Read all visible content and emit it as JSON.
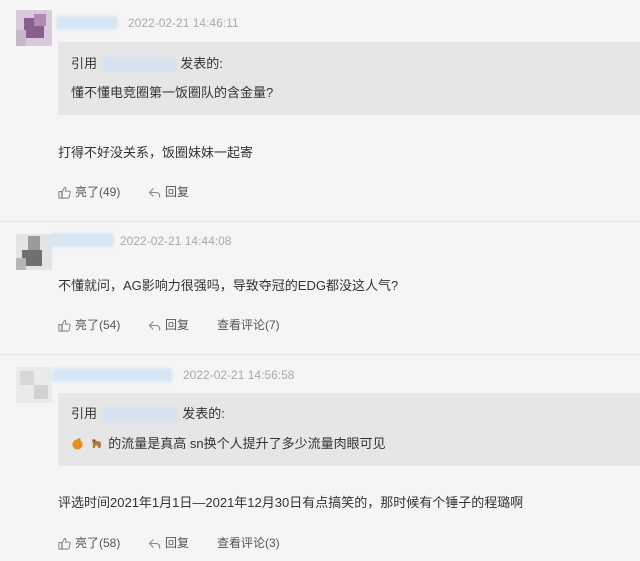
{
  "comments": [
    {
      "time": "2022-02-21 14:46:11",
      "quote": {
        "prefix": "引用",
        "suffix": "发表的:",
        "text": "懂不懂电竞圈第一饭圈队的含金量?"
      },
      "text": "打得不好没关系，饭圈妹妹一起寄",
      "like_label": "亮了(49)",
      "reply_label": "回复"
    },
    {
      "time": "2022-02-21 14:44:08",
      "text": "不懂就问，AG影响力很强吗，导致夺冠的EDG都没这人气?",
      "like_label": "亮了(54)",
      "reply_label": "回复",
      "view_label": "查看评论(7)"
    },
    {
      "time": "2022-02-21 14:56:58",
      "quote": {
        "prefix": "引用",
        "suffix": "发表的:",
        "text": "的流量是真高 sn换个人提升了多少流量肉眼可见"
      },
      "text": "评选时间2021年1月1日—2021年12月30日有点搞笑的，那时候有个锤子的程璐啊",
      "like_label": "亮了(58)",
      "reply_label": "回复",
      "view_label": "查看评论(3)"
    }
  ],
  "icons": {
    "like": "thumbs-up-icon",
    "reply": "reply-arrow-icon",
    "emoji_1": "tangerine-emoji-icon",
    "emoji_2": "dog-emoji-icon"
  },
  "colors": {
    "background": "#f5f5f5",
    "quote_bg": "#e6e6e6",
    "text": "#333333",
    "time": "#aaaaaa"
  }
}
